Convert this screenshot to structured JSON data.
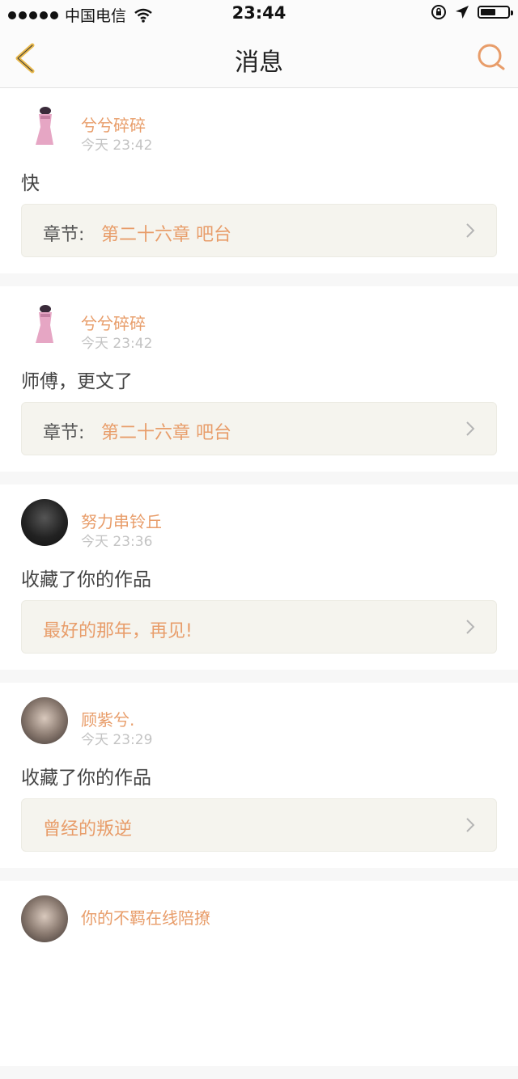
{
  "status_bar": {
    "carrier": "中国电信",
    "time": "23:44"
  },
  "nav": {
    "title": "消息",
    "accent_color": "#e89d6a",
    "back_icon": "chevron-left-icon",
    "search_icon": "search-icon"
  },
  "messages": [
    {
      "username": "兮兮碎碎",
      "time": "今天 23:42",
      "text": "快",
      "chapter_label": "章节:",
      "chapter_value": "第二十六章 吧台"
    },
    {
      "username": "兮兮碎碎",
      "time": "今天 23:42",
      "text": "师傅，更文了",
      "chapter_label": "章节:",
      "chapter_value": "第二十六章 吧台"
    },
    {
      "username": "努力串铃丘",
      "time": "今天 23:36",
      "text": "收藏了你的作品",
      "work_title": "最好的那年，再见!"
    },
    {
      "username": "顾紫兮.",
      "time": "今天 23:29",
      "text": "收藏了你的作品",
      "work_title": "曾经的叛逆"
    },
    {
      "username": "你的不羁在线陪撩"
    }
  ]
}
